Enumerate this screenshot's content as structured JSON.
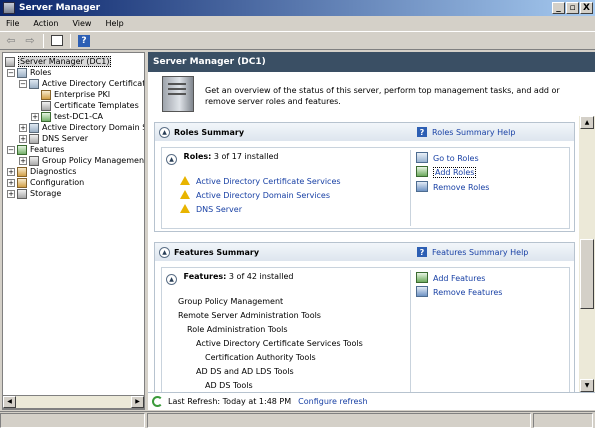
{
  "window": {
    "title": "Server Manager",
    "controls": [
      "_",
      "`",
      "X"
    ]
  },
  "menu": [
    "File",
    "Action",
    "View",
    "Help"
  ],
  "toolbar": {
    "back_icon": "back-arrow-icon",
    "forward_icon": "forward-arrow-icon",
    "help_label": "?"
  },
  "tree": {
    "items": [
      {
        "label": "Server Manager (DC1)",
        "expander": "",
        "icon": "server-manager-icon"
      },
      {
        "label": "Roles",
        "expander": "−",
        "icon": "roles-icon"
      },
      {
        "label": "Active Directory Certificate",
        "expander": "−",
        "icon": "certificate-services-icon"
      },
      {
        "label": "Enterprise PKI",
        "expander": "",
        "icon": "pki-icon"
      },
      {
        "label": "Certificate Templates",
        "expander": "",
        "icon": "templates-icon"
      },
      {
        "label": "test-DC1-CA",
        "expander": "+",
        "icon": "ca-icon"
      },
      {
        "label": "Active Directory Domain Se",
        "expander": "+",
        "icon": "domain-services-icon"
      },
      {
        "label": "DNS Server",
        "expander": "+",
        "icon": "dns-icon"
      },
      {
        "label": "Features",
        "expander": "−",
        "icon": "features-icon"
      },
      {
        "label": "Group Policy Management",
        "expander": "+",
        "icon": "group-policy-icon"
      },
      {
        "label": "Diagnostics",
        "expander": "+",
        "icon": "diagnostics-icon"
      },
      {
        "label": "Configuration",
        "expander": "+",
        "icon": "configuration-icon"
      },
      {
        "label": "Storage",
        "expander": "+",
        "icon": "storage-icon"
      }
    ]
  },
  "main": {
    "header": "Server Manager (DC1)",
    "overview": "Get an overview of the status of this server, perform top management tasks, and add or remove server roles and features.",
    "roles_summary": {
      "title": "Roles Summary",
      "help": "Roles Summary Help",
      "count_label": "Roles:",
      "count_value": "3 of 17 installed",
      "roles": [
        "Active Directory Certificate Services",
        "Active Directory Domain Services",
        "DNS Server"
      ],
      "actions": [
        "Go to Roles",
        "Add Roles",
        "Remove Roles"
      ]
    },
    "features_summary": {
      "title": "Features Summary",
      "help": "Features Summary Help",
      "count_label": "Features:",
      "count_value": "3 of 42 installed",
      "features": [
        "Group Policy Management",
        "Remote Server Administration Tools",
        "Role Administration Tools",
        "Active Directory Certificate Services Tools",
        "Certification Authority Tools",
        "AD DS and AD LDS Tools",
        "AD DS Tools"
      ],
      "actions": [
        "Add Features",
        "Remove Features"
      ]
    },
    "refresh": {
      "text": "Last Refresh: Today at 1:48 PM",
      "link": "Configure refresh"
    }
  }
}
